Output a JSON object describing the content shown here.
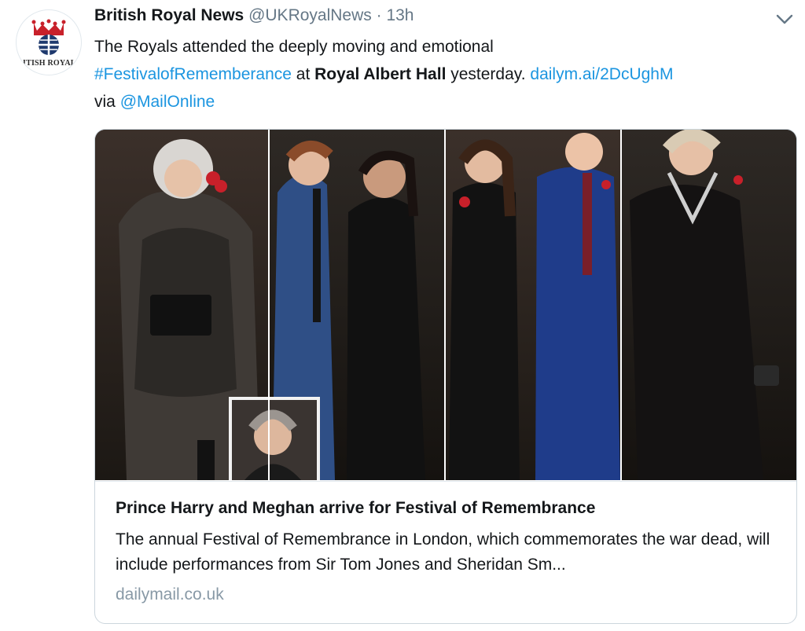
{
  "tweet": {
    "author_name": "British Royal News",
    "author_handle": "@UKRoyalNews",
    "separator": " · ",
    "time": "13h",
    "avatar_text": "RITISH ROYALS",
    "text_line1": "The Royals attended the deeply moving and emotional",
    "hashtag": "#FestivalofRememberance",
    "text_at": " at ",
    "venue": "Royal Albert Hall",
    "text_yesterday": " yesterday. ",
    "link": "dailym.ai/2DcUghM",
    "text_via": "via ",
    "mention": "@MailOnline",
    "menu_icon": "chevron-down-icon"
  },
  "card": {
    "title": "Prince Harry and Meghan arrive for Festival of Remembrance",
    "description": "The annual Festival of Remembrance in London, which commemorates the war dead, will include performances from Sir Tom Jones and Sheridan Sm...",
    "domain": "dailymail.co.uk"
  },
  "colors": {
    "link": "#1b95e0",
    "muted": "#657786",
    "border": "#ccd6dd",
    "text": "#14171a",
    "avatar_crown": "#c8202a",
    "avatar_globe": "#1f3a6e"
  }
}
